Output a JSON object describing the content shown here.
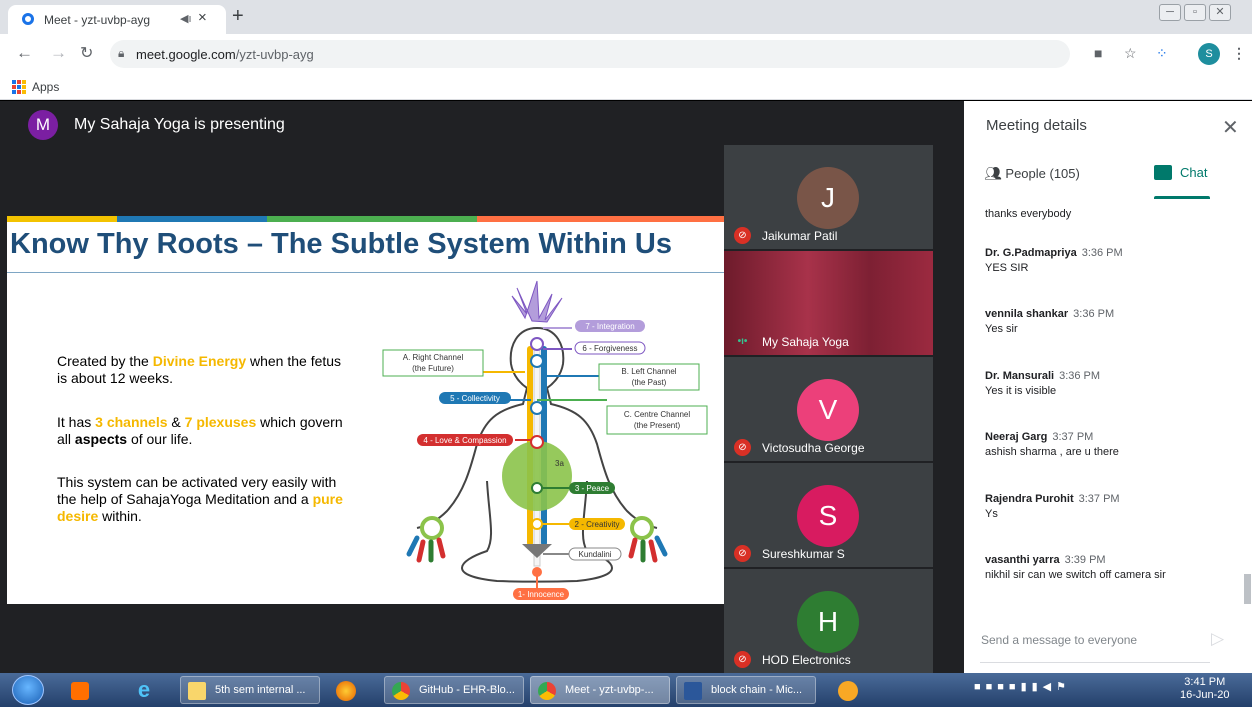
{
  "browser": {
    "tab_title": "Meet - yzt-uvbp-ayg",
    "tab_audio_icon": "speaker-icon",
    "tab_close": "×",
    "new_tab": "+",
    "url_host": "meet.google.com",
    "url_path": "/yzt-uvbp-ayg",
    "profile_initial": "S",
    "bookmark_apps": "Apps",
    "window_buttons": [
      "─",
      "▫",
      "✕"
    ]
  },
  "meet": {
    "presenter_initial": "M",
    "presenter_text": "My Sahaja Yoga is presenting",
    "slide": {
      "title": "Know Thy Roots – The Subtle System Within Us",
      "bullet1_a": "Created by the ",
      "bullet1_b": "Divine Energy",
      "bullet1_c": " when the fetus is about 12 weeks.",
      "bullet2_a": "It has ",
      "bullet2_b": "3 channels",
      "bullet2_c": " & ",
      "bullet2_d": "7 plexuses",
      "bullet2_e": " which govern all ",
      "bullet2_f": "aspects",
      "bullet2_g": " of our life.",
      "bullet3_a": "This system can be activated very easily with the help of SahajaYoga Meditation and a ",
      "bullet3_b": "pure desire",
      "bullet3_c": " within.",
      "diagram_labels": {
        "right_channel": "A. Right Channel",
        "right_channel_sub": "(the Future)",
        "left_channel": "B. Left Channel",
        "left_channel_sub": "(the Past)",
        "centre_channel": "C. Centre Channel",
        "centre_channel_sub": "(the Present)",
        "integration": "7 - Integration",
        "forgiveness": "6 - Forgiveness",
        "collectivity": "5 - Collectivity",
        "love": "4 - Love & Compassion",
        "peace": "3 - Peace",
        "creativity": "2 - Creativity",
        "kundalini": "Kundalini",
        "innocence": "1- Innocence",
        "center_3a": "3a"
      }
    },
    "participants": [
      {
        "name": "Jaikumar Patil",
        "initial": "J",
        "color": "#795548",
        "muted": true
      },
      {
        "name": "My Sahaja Yoga",
        "initial": "",
        "color": "#8b2a3a",
        "muted": false
      },
      {
        "name": "Victosudha George",
        "initial": "V",
        "color": "#ec407a",
        "muted": true
      },
      {
        "name": "Sureshkumar S",
        "initial": "S",
        "color": "#d81b60",
        "muted": true
      },
      {
        "name": "HOD Electronics",
        "initial": "H",
        "color": "#2e7d32",
        "muted": true
      }
    ]
  },
  "panel": {
    "title": "Meeting details",
    "close": "✕",
    "people_tab": "People (105)",
    "chat_tab": "Chat",
    "messages": [
      {
        "sender": "",
        "time": "",
        "text": "thanks everybody"
      },
      {
        "sender": "Dr. G.Padmapriya",
        "time": "3:36 PM",
        "text": "YES SIR"
      },
      {
        "sender": "vennila shankar",
        "time": "3:36 PM",
        "text": "Yes sir"
      },
      {
        "sender": "Dr. Mansurali",
        "time": "3:36 PM",
        "text": "Yes it is visible"
      },
      {
        "sender": "Neeraj Garg",
        "time": "3:37 PM",
        "text": "ashish sharma , are u there"
      },
      {
        "sender": "Rajendra Purohit",
        "time": "3:37 PM",
        "text": "Ys"
      },
      {
        "sender": "vasanthi yarra",
        "time": "3:39 PM",
        "text": "nikhil sir can we switch off camera sir"
      }
    ],
    "input_placeholder": "Send a message to everyone"
  },
  "taskbar": {
    "apps": [
      {
        "label": "5th sem internal ...",
        "icon": "folder-icon"
      },
      {
        "label": "GitHub - EHR-Blo...",
        "icon": "chrome-icon"
      },
      {
        "label": "Meet - yzt-uvbp-...",
        "icon": "chrome-icon"
      },
      {
        "label": "block chain - Mic...",
        "icon": "word-icon"
      }
    ],
    "time": "3:41 PM",
    "date": "16-Jun-20"
  },
  "colors": {
    "meet_teal": "#00796b",
    "slide_title": "#1f4e79",
    "highlight": "#f5b800",
    "mute_red": "#d93025"
  }
}
